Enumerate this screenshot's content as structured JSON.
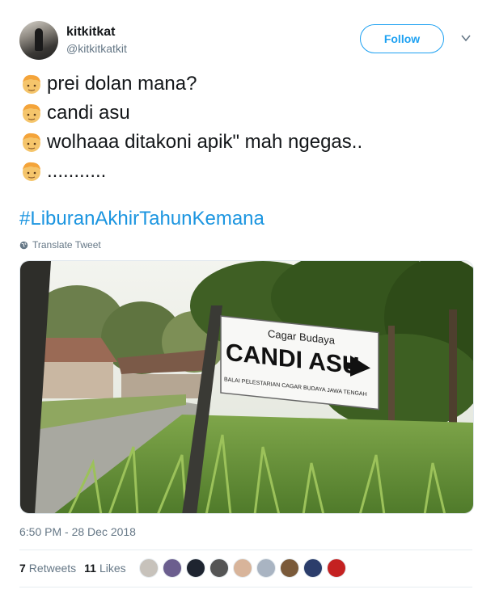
{
  "user": {
    "display_name": "kitkitkat",
    "handle": "@kitkitkatkit"
  },
  "follow_label": "Follow",
  "tweet": {
    "lines": [
      {
        "emoji": "boy-face-icon",
        "text": "prei dolan mana?"
      },
      {
        "emoji": "boy-face-icon",
        "text": "candi asu"
      },
      {
        "emoji": "boy-face-icon",
        "text": "wolhaaa ditakoni apik\" mah ngegas.."
      },
      {
        "emoji": "boy-face-icon",
        "text": "..........."
      }
    ],
    "hashtag": "#LiburanAkhirTahunKemana",
    "translate_label": "Translate Tweet"
  },
  "photo": {
    "sign_top": "Cagar Budaya",
    "sign_main": "CANDI ASU",
    "sign_bottom": "BALAI PELESTARIAN CAGAR BUDAYA JAWA TENGAH"
  },
  "timestamp": "6:50 PM - 28 Dec 2018",
  "stats": {
    "retweets_count": "7",
    "retweets_label": "Retweets",
    "likes_count": "11",
    "likes_label": "Likes"
  },
  "colors": {
    "accent": "#1da1f2",
    "hashtag": "#1b95e0",
    "muted": "#657786"
  },
  "liker_avatars": 9
}
